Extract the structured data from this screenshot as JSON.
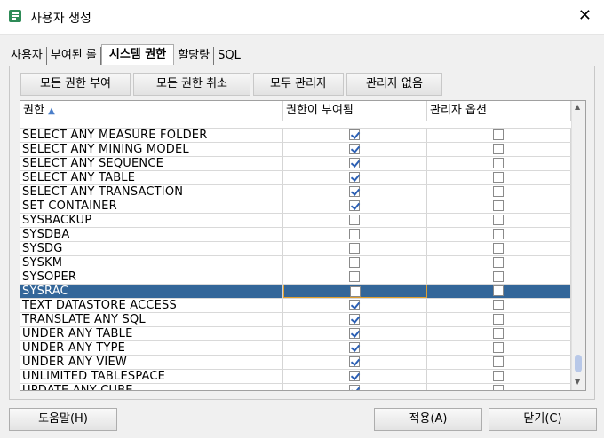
{
  "window": {
    "title": "사용자 생성",
    "close_glyph": "✕"
  },
  "tabs": [
    "사용자",
    "부여된 롤",
    "시스템 권한",
    "할당량",
    "SQL"
  ],
  "active_tab_index": 2,
  "toolbar": [
    "모든 권한 부여",
    "모든 권한 취소",
    "모두 관리자",
    "관리자 없음"
  ],
  "table": {
    "columns": [
      "권한",
      "권한이 부여됨",
      "관리자 옵션"
    ],
    "sort_glyph": "▲",
    "rows": [
      {
        "name": "SELECT ANY MEASURE FOLDER",
        "granted": true,
        "admin": false
      },
      {
        "name": "SELECT ANY MINING MODEL",
        "granted": true,
        "admin": false
      },
      {
        "name": "SELECT ANY SEQUENCE",
        "granted": true,
        "admin": false
      },
      {
        "name": "SELECT ANY TABLE",
        "granted": true,
        "admin": false
      },
      {
        "name": "SELECT ANY TRANSACTION",
        "granted": true,
        "admin": false
      },
      {
        "name": "SET CONTAINER",
        "granted": true,
        "admin": false
      },
      {
        "name": "SYSBACKUP",
        "granted": false,
        "admin": false
      },
      {
        "name": "SYSDBA",
        "granted": false,
        "admin": false
      },
      {
        "name": "SYSDG",
        "granted": false,
        "admin": false
      },
      {
        "name": "SYSKM",
        "granted": false,
        "admin": false
      },
      {
        "name": "SYSOPER",
        "granted": false,
        "admin": false
      },
      {
        "name": "SYSRAC",
        "granted": false,
        "admin": false,
        "selected": true
      },
      {
        "name": "TEXT DATASTORE ACCESS",
        "granted": true,
        "admin": false
      },
      {
        "name": "TRANSLATE ANY SQL",
        "granted": true,
        "admin": false
      },
      {
        "name": "UNDER ANY TABLE",
        "granted": true,
        "admin": false
      },
      {
        "name": "UNDER ANY TYPE",
        "granted": true,
        "admin": false
      },
      {
        "name": "UNDER ANY VIEW",
        "granted": true,
        "admin": false
      },
      {
        "name": "UNLIMITED TABLESPACE",
        "granted": true,
        "admin": false
      },
      {
        "name": "UPDATE ANY CUBE",
        "granted": true,
        "admin": false
      }
    ]
  },
  "footer": {
    "help": "도움말(H)",
    "apply": "적용(A)",
    "close": "닫기(C)"
  }
}
